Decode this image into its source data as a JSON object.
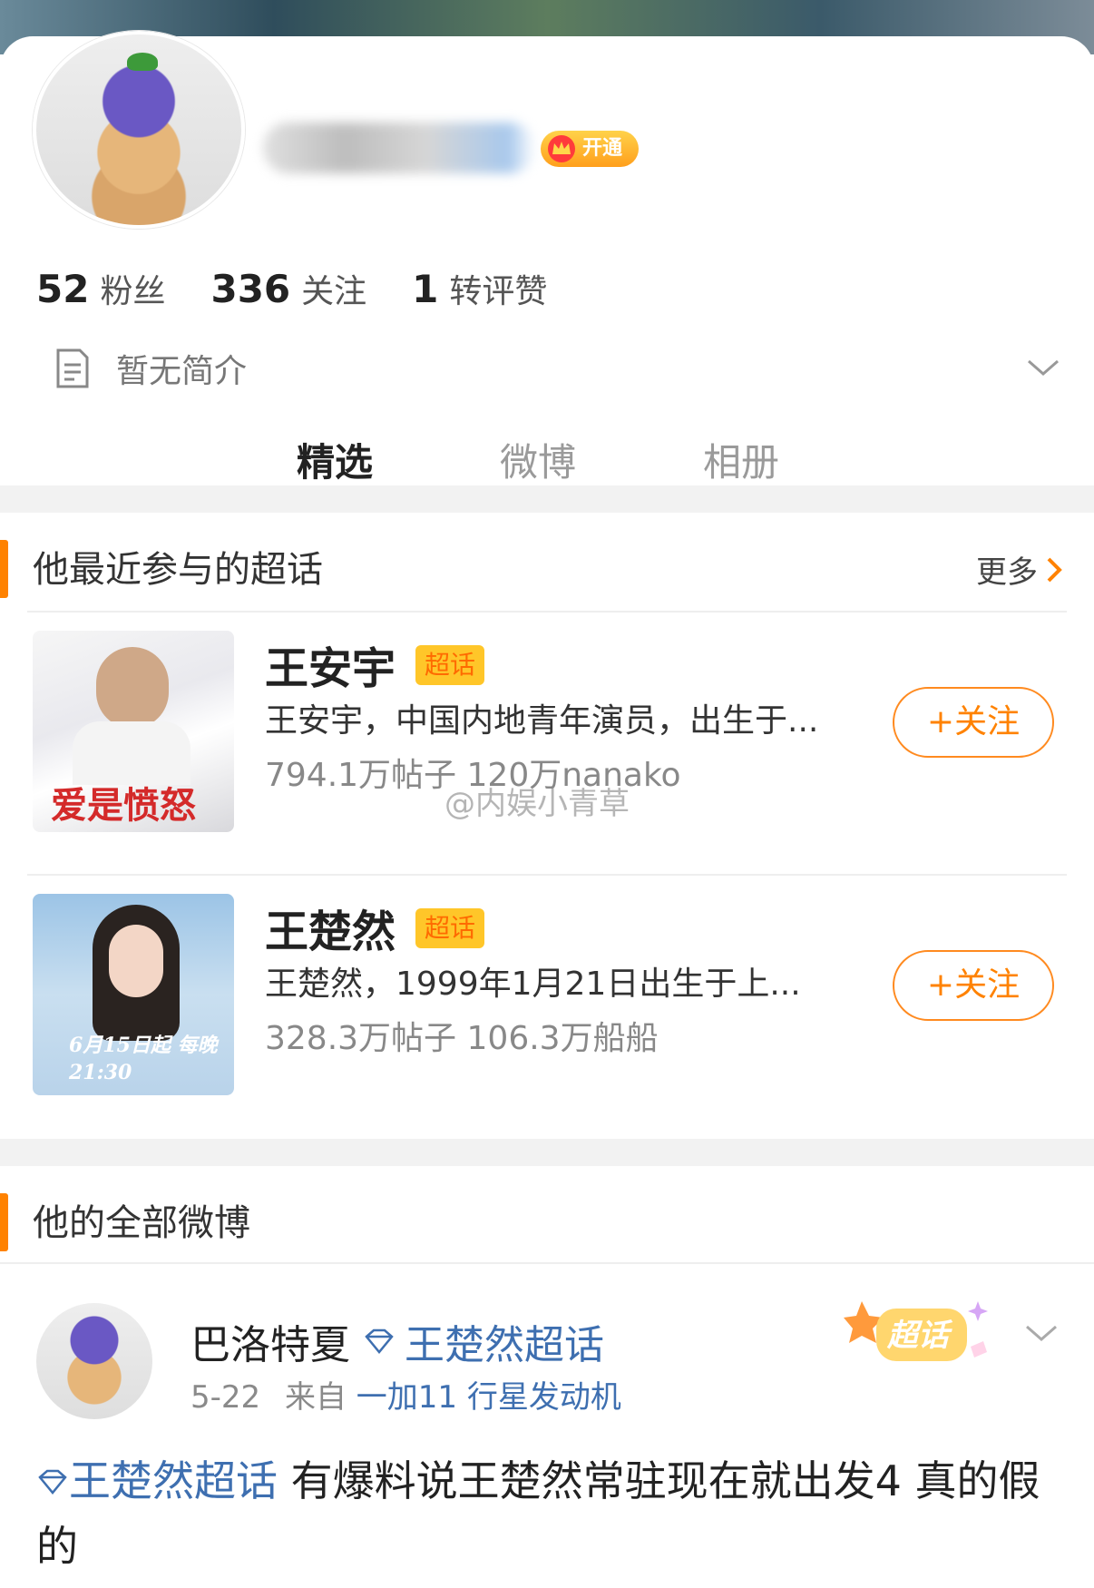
{
  "profile": {
    "vip_label": "开通",
    "stats": [
      {
        "num": "52",
        "label": "粉丝"
      },
      {
        "num": "336",
        "label": "关注"
      },
      {
        "num": "1",
        "label": "转评赞"
      }
    ],
    "bio": "暂无简介"
  },
  "tabs": [
    {
      "label": "精选",
      "active": true
    },
    {
      "label": "微博",
      "active": false
    },
    {
      "label": "相册",
      "active": false
    }
  ],
  "topics_section": {
    "title": "他最近参与的超话",
    "more_label": "更多",
    "items": [
      {
        "name": "王安宇",
        "tag": "超话",
        "desc": "王安宇，中国内地青年演员，出生于...",
        "stats": "794.1万帖子 120万nanako",
        "follow_label": "+关注",
        "thumb_text": "爱是愤怒"
      },
      {
        "name": "王楚然",
        "tag": "超话",
        "desc": "王楚然，1999年1月21日出生于上...",
        "stats": "328.3万帖子 106.3万船船",
        "follow_label": "+关注",
        "thumb_text": "6月15日起 每晚21:30"
      }
    ]
  },
  "watermark": "@内娱小青草",
  "posts_section": {
    "title": "他的全部微博",
    "post": {
      "author": "巴洛特夏",
      "topic": "王楚然超话",
      "date": "5-22",
      "from_label": "来自",
      "source": "一加11 行星发动机",
      "sticker_label": "超话",
      "body_topic": "王楚然超话",
      "body_text": " 有爆料说王楚然常驻现在就出发4 真的假的"
    }
  },
  "colors": {
    "accent": "#ff8200",
    "link": "#3e6fb0",
    "tag_bg": "#ffc629"
  }
}
